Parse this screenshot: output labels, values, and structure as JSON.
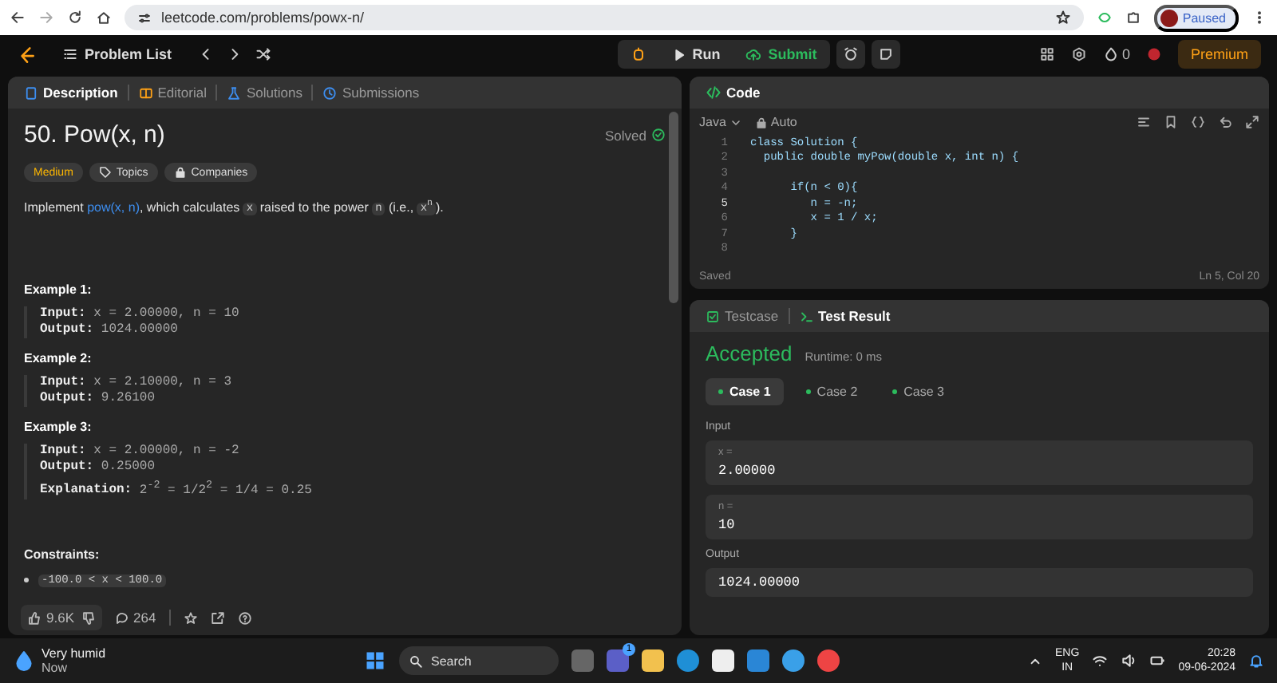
{
  "browser": {
    "url": "leetcode.com/problems/powx-n/",
    "profile": "Paused"
  },
  "navbar": {
    "problem_list": "Problem List",
    "run": "Run",
    "submit": "Submit",
    "streak": "0",
    "premium": "Premium"
  },
  "left_tabs": [
    {
      "label": "Description",
      "selected": true
    },
    {
      "label": "Editorial",
      "selected": false
    },
    {
      "label": "Solutions",
      "selected": false
    },
    {
      "label": "Submissions",
      "selected": false
    }
  ],
  "problem": {
    "title": "50. Pow(x, n)",
    "status": "Solved",
    "difficulty": "Medium",
    "tags": [
      "Topics",
      "Companies"
    ],
    "description": [
      {
        "kind": "text",
        "text": "Implement "
      },
      {
        "kind": "link",
        "text": "pow(x, n)"
      },
      {
        "kind": "text",
        "text": ", which calculates "
      },
      {
        "kind": "code",
        "text": "x"
      },
      {
        "kind": "text",
        "text": " raised to the power "
      },
      {
        "kind": "code",
        "text": "n"
      },
      {
        "kind": "text",
        "text": " (i.e., "
      },
      {
        "kind": "code",
        "text": "x$^{n}$"
      },
      {
        "kind": "text",
        "text": ")."
      }
    ],
    "examples": [
      {
        "title": "Example 1:",
        "lines": [
          {
            "label": "Input:",
            "value": "x = 2.00000, n = 10"
          },
          {
            "label": "Output:",
            "value": "1024.00000"
          }
        ]
      },
      {
        "title": "Example 2:",
        "lines": [
          {
            "label": "Input:",
            "value": "x = 2.10000, n = 3"
          },
          {
            "label": "Output:",
            "value": "9.26100"
          }
        ]
      },
      {
        "title": "Example 3:",
        "lines": [
          {
            "label": "Input:",
            "value": "x = 2.00000, n = -2"
          },
          {
            "label": "Output:",
            "value": "0.25000"
          },
          {
            "label": "Explanation:",
            "value": "2$^{-2}$ = 1/2$^{2}$ = 1/4 = 0.25"
          }
        ]
      }
    ],
    "constraints_title": "Constraints:",
    "constraints": [
      "-100.0 < x < 100.0"
    ]
  },
  "footer": {
    "likes": "9.6K",
    "comments": "264"
  },
  "code_panel": {
    "title": "Code",
    "language": "Java",
    "mode": "Auto",
    "lines": [
      {
        "number": "1",
        "code": "class Solution {",
        "active": false
      },
      {
        "number": "2",
        "code": "  public double myPow(double x, int n) {",
        "active": false
      },
      {
        "number": "3",
        "active": false
      },
      {
        "number": "4",
        "code": "      if(n < 0){",
        "active": false
      },
      {
        "number": "5",
        "code": "         n = -n;",
        "active": true
      },
      {
        "number": "6",
        "code": "         x = 1 / x;",
        "active": false
      },
      {
        "number": "7",
        "code": "      }",
        "active": false
      },
      {
        "number": "8",
        "active": false
      }
    ],
    "status": "Saved",
    "cursor": "Ln 5, Col 20"
  },
  "result_tabs": [
    {
      "label": "Testcase",
      "selected": false
    },
    {
      "label": "Test Result",
      "selected": true
    }
  ],
  "result": {
    "verdict": "Accepted",
    "runtime": "Runtime: 0 ms",
    "cases": [
      {
        "label": "Case 1",
        "selected": true
      },
      {
        "label": "Case 2",
        "selected": false
      },
      {
        "label": "Case 3",
        "selected": false
      }
    ],
    "input_label": "Input",
    "inputs": [
      {
        "name": "x =",
        "value": "2.00000"
      },
      {
        "name": "n =",
        "value": "10"
      }
    ],
    "output_label": "Output",
    "output": "1024.00000"
  },
  "taskbar": {
    "weather": "Very humid",
    "weather_sub": "Now",
    "search": "Search",
    "teams_badge": "1",
    "lang": "ENG",
    "region": "IN",
    "time": "20:28",
    "date": "09-06-2024"
  }
}
